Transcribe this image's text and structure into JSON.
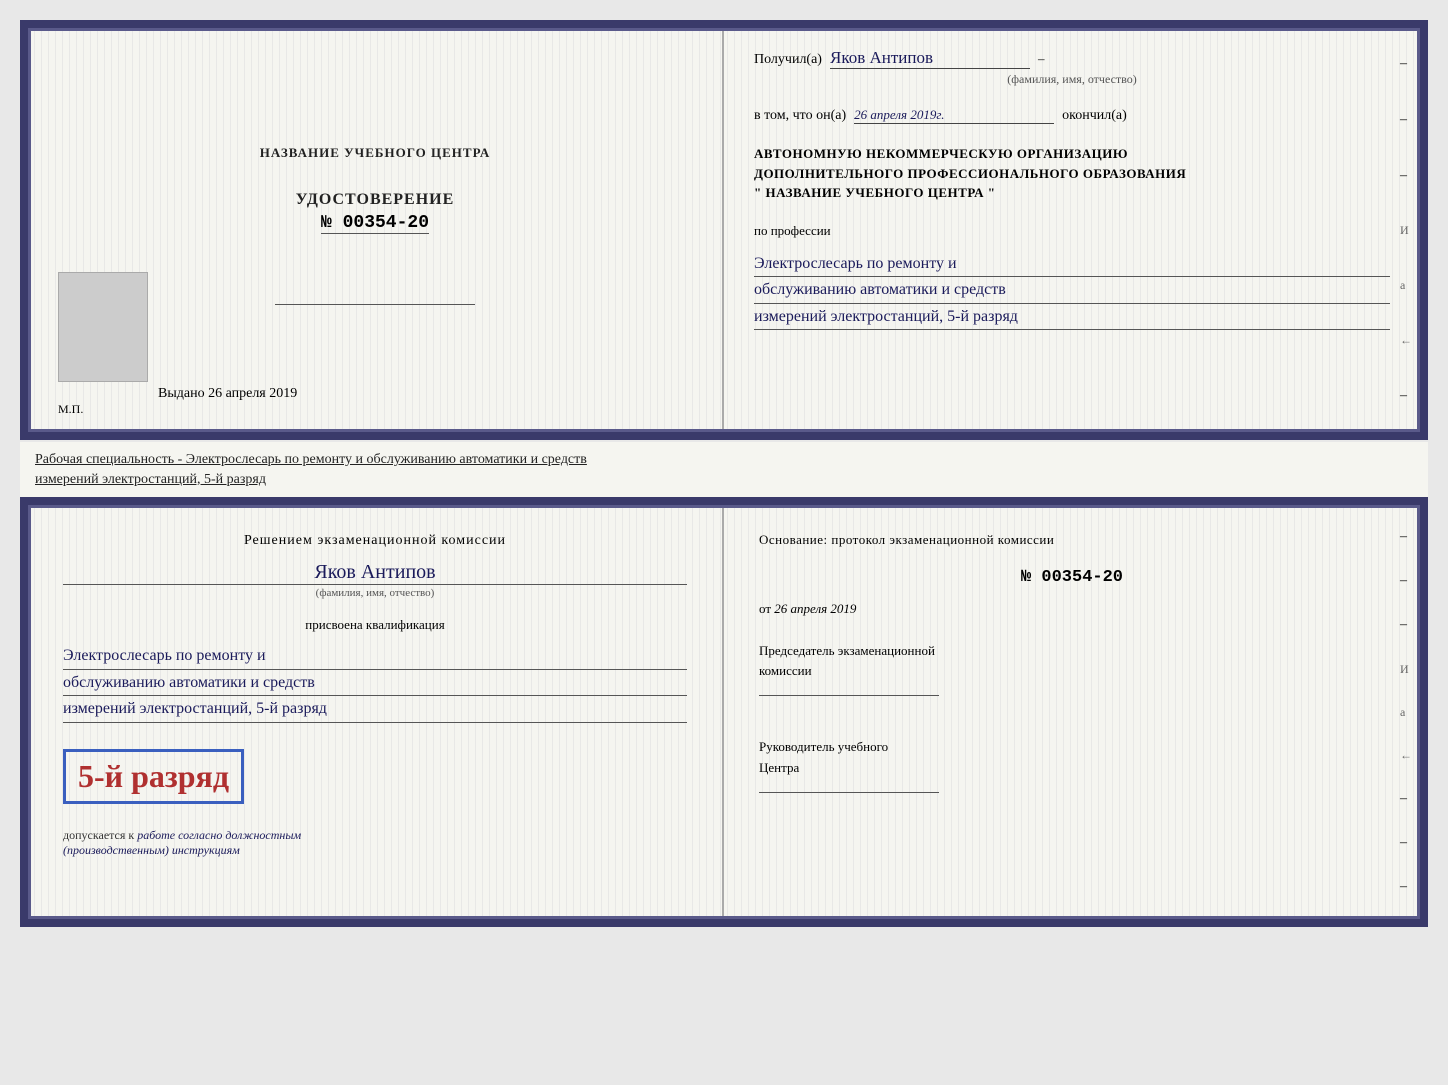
{
  "doc_top": {
    "left": {
      "center_title": "НАЗВАНИЕ УЧЕБНОГО ЦЕНТРА",
      "cert_label": "УДОСТОВЕРЕНИЕ",
      "cert_number": "№ 00354-20",
      "issued_label": "Выдано",
      "issued_date": "26 апреля 2019",
      "stamp": "М.П."
    },
    "right": {
      "received_prefix": "Получил(а)",
      "received_name": "Яков Антипов",
      "fio_label": "(фамилия, имя, отчество)",
      "in_that_prefix": "в том, что он(а)",
      "in_that_date": "26 апреля 2019г.",
      "finished_label": "окончил(а)",
      "org_line1": "АВТОНОМНУЮ НЕКОММЕРЧЕСКУЮ ОРГАНИЗАЦИЮ",
      "org_line2": "ДОПОЛНИТЕЛЬНОГО ПРОФЕССИОНАЛЬНОГО ОБРАЗОВАНИЯ",
      "org_line3": "\"   НАЗВАНИЕ УЧЕБНОГО ЦЕНТРА   \"",
      "profession_prefix": "по профессии",
      "profession_line1": "Электрослесарь по ремонту и",
      "profession_line2": "обслуживанию автоматики и средств",
      "profession_line3": "измерений электростанций, 5-й разряд"
    }
  },
  "between_label": {
    "line1": "Рабочая специальность - Электрослесарь по ремонту и обслуживанию автоматики и средств",
    "line2": "измерений электростанций, 5-й разряд"
  },
  "doc_bottom": {
    "left": {
      "commission_line1": "Решением экзаменационной комиссии",
      "person_name": "Яков Антипов",
      "fio_label": "(фамилия, имя, отчество)",
      "qualification_prefix": "присвоена квалификация",
      "qual_line1": "Электрослесарь по ремонту и",
      "qual_line2": "обслуживанию автоматики и средств",
      "qual_line3": "измерений электростанций, 5-й разряд",
      "rank_text": "5-й разряд",
      "allowed_prefix": "допускается к",
      "allowed_italic": "работе согласно должностным",
      "allowed_italic2": "(производственным) инструкциям"
    },
    "right": {
      "basis_label": "Основание: протокол экзаменационной комиссии",
      "protocol_num": "№ 00354-20",
      "date_prefix": "от",
      "date_val": "26 апреля 2019",
      "chairman_line1": "Председатель экзаменационной",
      "chairman_line2": "комиссии",
      "head_line1": "Руководитель учебного",
      "head_line2": "Центра"
    }
  },
  "right_sidebar": {
    "items": [
      "–",
      "–",
      "–",
      "И",
      "а",
      "←",
      "–",
      "–",
      "–",
      "–",
      "–"
    ]
  }
}
